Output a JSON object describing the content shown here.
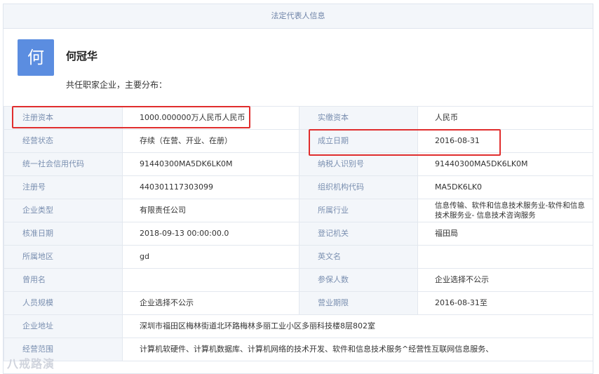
{
  "header": {
    "title": "法定代表人信息"
  },
  "person": {
    "avatar_char": "何",
    "name": "何冠华",
    "desc": "共任职家企业，主要分布："
  },
  "rows": [
    {
      "l1": "注册资本",
      "v1": "1000.000000万人民币人民币",
      "l2": "实缴资本",
      "v2": "人民币"
    },
    {
      "l1": "经营状态",
      "v1": "存续（在营、开业、在册）",
      "l2": "成立日期",
      "v2": "2016-08-31"
    },
    {
      "l1": "统一社会信用代码",
      "v1": "91440300MA5DK6LK0M",
      "l2": "纳税人识别号",
      "v2": "91440300MA5DK6LK0M"
    },
    {
      "l1": "注册号",
      "v1": "440301117303099",
      "l2": "组织机构代码",
      "v2": "MA5DK6LK0"
    },
    {
      "l1": "企业类型",
      "v1": "有限责任公司",
      "l2": "所属行业",
      "v2": "信息传输、软件和信息技术服务业-软件和信息技术服务业- 信息技术咨询服务"
    },
    {
      "l1": "核准日期",
      "v1": "2018-09-13 00:00:00.0",
      "l2": "登记机关",
      "v2": "福田局"
    },
    {
      "l1": "所属地区",
      "v1": "gd",
      "l2": "英文名",
      "v2": ""
    },
    {
      "l1": "曾用名",
      "v1": "",
      "l2": "参保人数",
      "v2": "企业选择不公示"
    },
    {
      "l1": "人员规模",
      "v1": "企业选择不公示",
      "l2": "营业期限",
      "v2": "2016-08-31至"
    }
  ],
  "address": {
    "label": "企业地址",
    "value": "深圳市福田区梅林街道北环路梅林多丽工业小区多丽科技楼8层802室"
  },
  "scope": {
    "label": "经营范围",
    "value": "计算机软硬件、计算机数据库、计算机网络的技术开发、软件和信息技术服务^经营性互联网信息服务、"
  },
  "watermark": "八戒路演",
  "highlight_color": "#e02d2d"
}
